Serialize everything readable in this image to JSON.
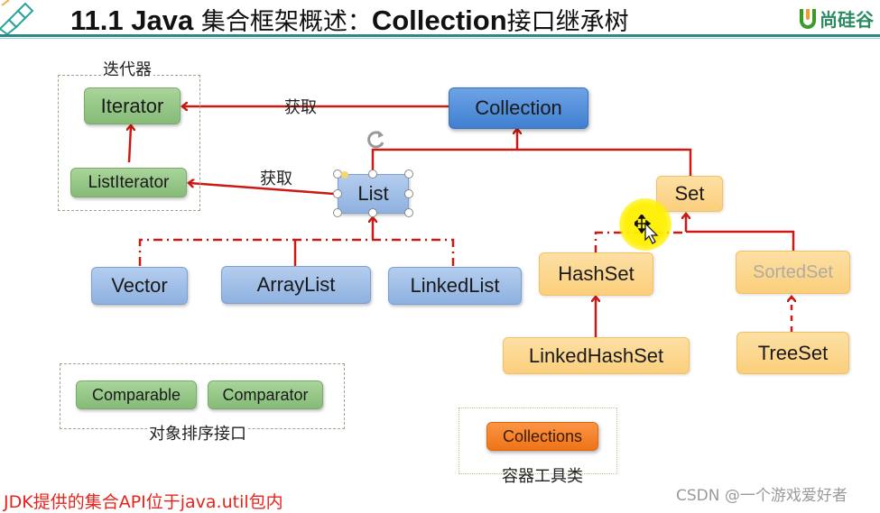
{
  "header": {
    "title_prefix": "11.1 Java ",
    "title_cn_1": "集合框架概述：",
    "title_mid": "Collection",
    "title_cn_2": "接口继承树",
    "logo_text": "尚硅谷",
    "corner_icon": "diamond-grid-icon",
    "brand_color": "#2a8a8a"
  },
  "iterator_group": {
    "caption": "迭代器",
    "nodes": [
      "Iterator",
      "ListIterator"
    ]
  },
  "arrows": {
    "obtain_label_top": "获取",
    "obtain_label_list": "获取"
  },
  "collection": {
    "label": "Collection"
  },
  "list_branch": {
    "parent": "List",
    "children": [
      "Vector",
      "ArrayList",
      "LinkedList"
    ]
  },
  "set_branch": {
    "parent": "Set",
    "hashset": "HashSet",
    "linkedhashset": "LinkedHashSet",
    "sortedset": "SortedSet",
    "treeset": "TreeSet"
  },
  "sorting_group": {
    "caption": "对象排序接口",
    "nodes": [
      "Comparable",
      "Comparator"
    ]
  },
  "tools_group": {
    "caption": "容器工具类",
    "node": "Collections"
  },
  "footnote": "JDK提供的集合API位于java.util包内",
  "watermark": "CSDN @一个游戏爱好者",
  "colors": {
    "arrow": "#cc1a12",
    "green_node": "#95c487",
    "blue_node": "#a3c0e8",
    "collection_node": "#4f8fdc",
    "yellow_node": "#fcd68e",
    "orange_node": "#f5821f",
    "footnote": "#e8231b"
  }
}
